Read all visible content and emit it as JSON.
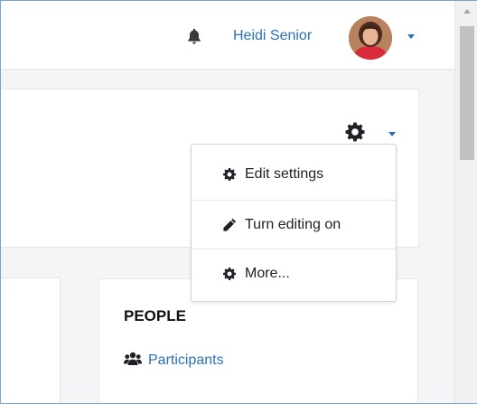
{
  "navbar": {
    "user_name": "Heidi Senior",
    "notification_icon": "bell-icon",
    "avatar_icon": "user-avatar"
  },
  "header": {
    "settings_icon": "gear-icon"
  },
  "settings_menu": {
    "items": [
      {
        "label": "Edit settings",
        "icon": "gear-icon"
      },
      {
        "label": "Turn editing on",
        "icon": "pencil-icon"
      },
      {
        "label": "More...",
        "icon": "gear-icon"
      }
    ]
  },
  "people_block": {
    "title": "PEOPLE",
    "link_label": "Participants",
    "link_icon": "users-icon"
  },
  "colors": {
    "link": "#2970b9",
    "text": "#1d2125",
    "page_background": "#f4f5f6"
  }
}
